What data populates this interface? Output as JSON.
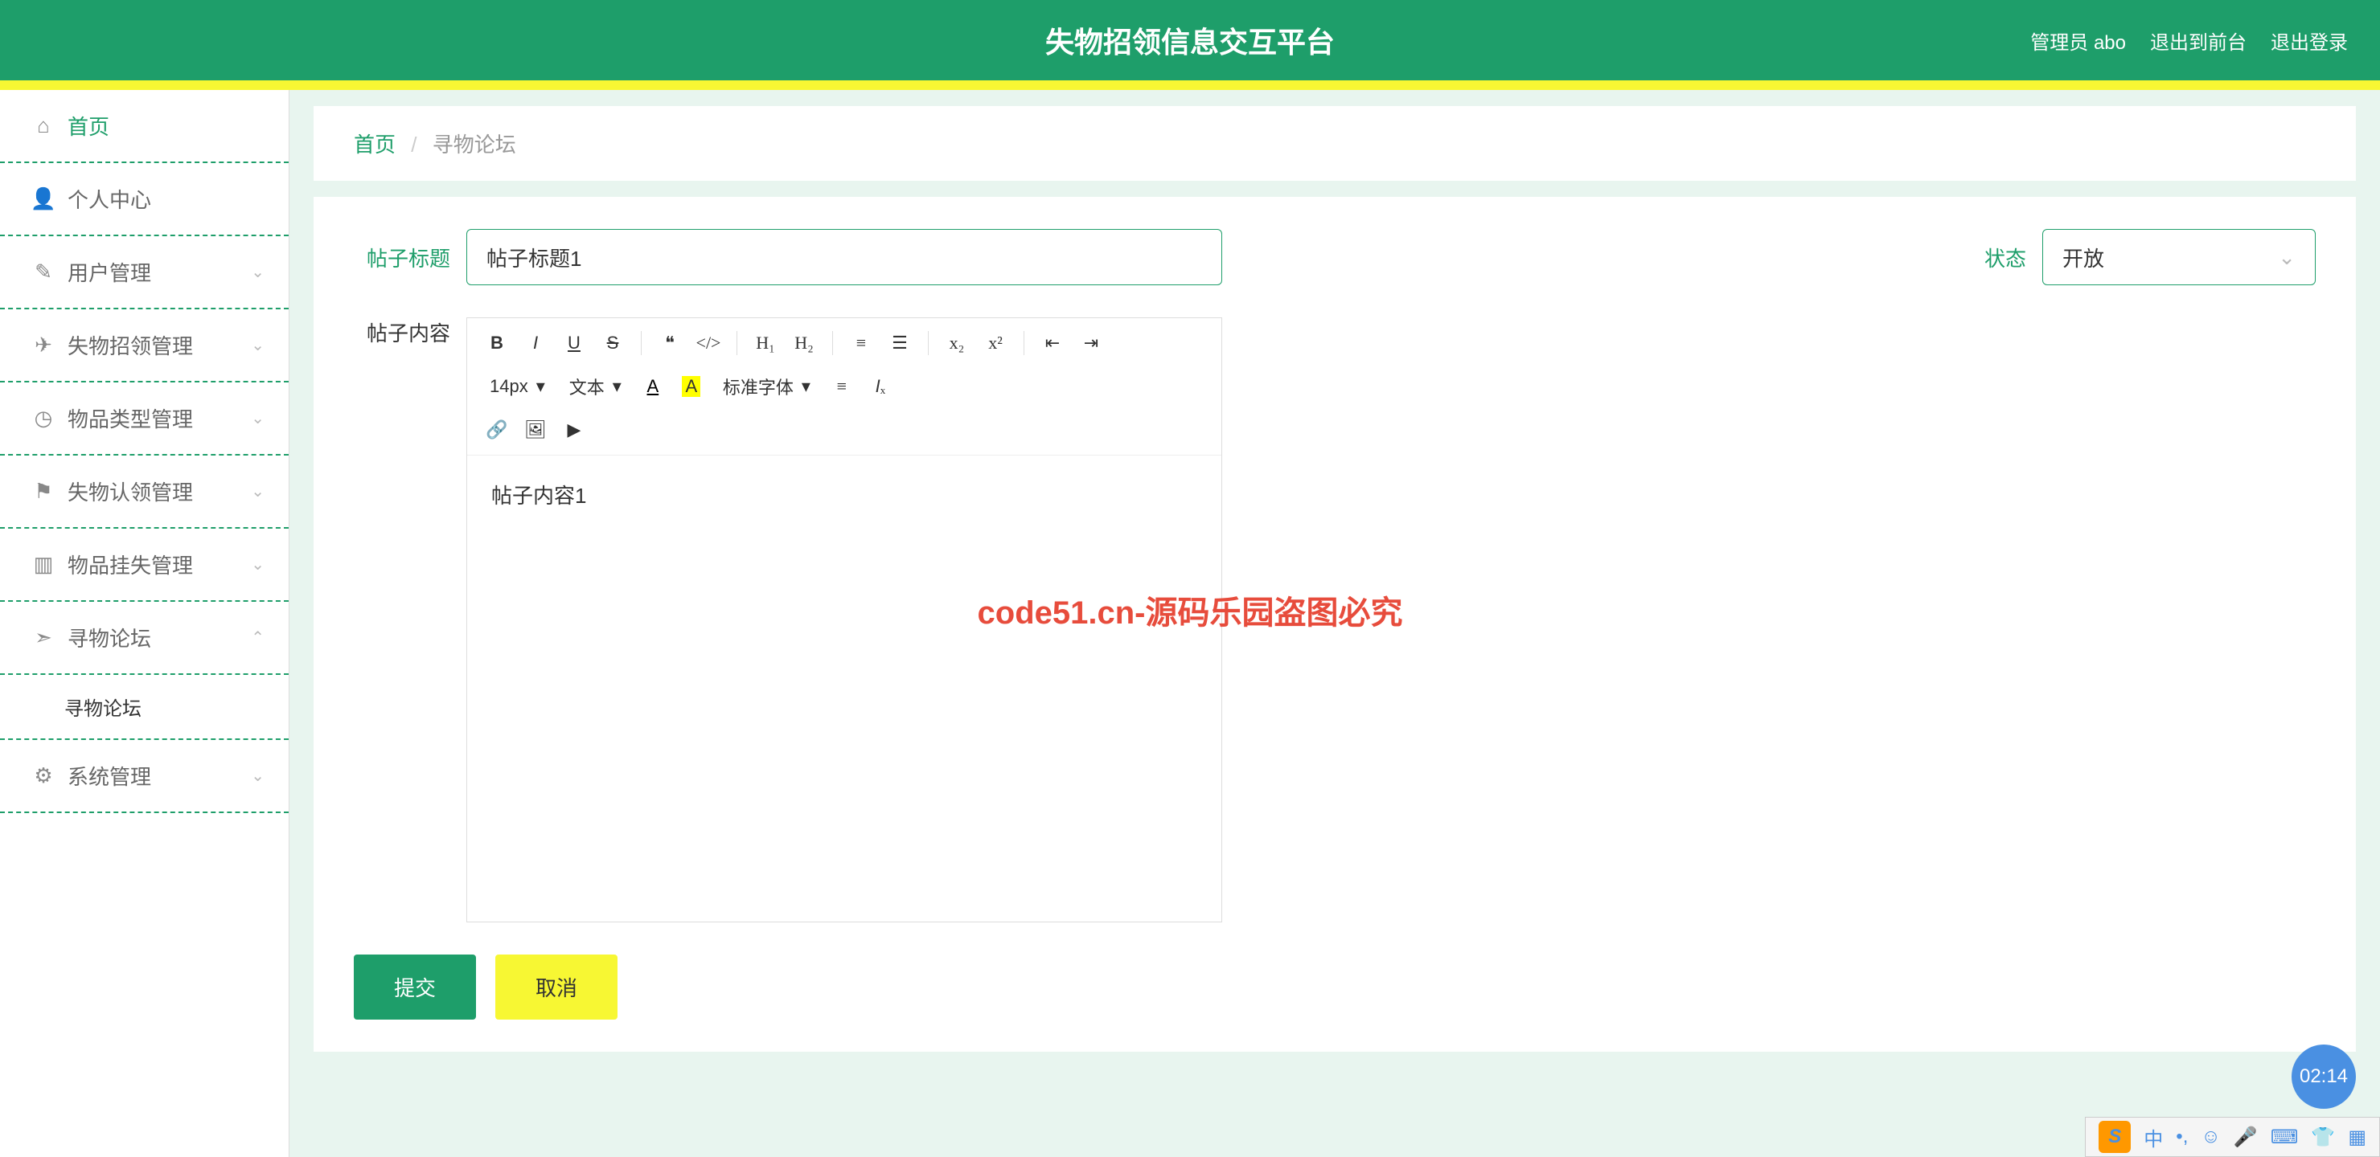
{
  "header": {
    "title": "失物招领信息交互平台",
    "admin_label": "管理员 abo",
    "back_front": "退出到前台",
    "logout": "退出登录"
  },
  "sidebar": {
    "items": [
      {
        "icon": "home",
        "label": "首页",
        "expandable": false
      },
      {
        "icon": "user",
        "label": "个人中心",
        "expandable": false
      },
      {
        "icon": "edit",
        "label": "用户管理",
        "expandable": true
      },
      {
        "icon": "send",
        "label": "失物招领管理",
        "expandable": true
      },
      {
        "icon": "clock",
        "label": "物品类型管理",
        "expandable": true
      },
      {
        "icon": "flag",
        "label": "失物认领管理",
        "expandable": true
      },
      {
        "icon": "bars",
        "label": "物品挂失管理",
        "expandable": true
      },
      {
        "icon": "nav",
        "label": "寻物论坛",
        "expandable": true,
        "expanded": true
      },
      {
        "icon": "gear",
        "label": "系统管理",
        "expandable": true
      }
    ],
    "submenu_forum": "寻物论坛"
  },
  "breadcrumb": {
    "home": "首页",
    "sep": "/",
    "current": "寻物论坛"
  },
  "form": {
    "title_label": "帖子标题",
    "title_value": "帖子标题1",
    "status_label": "状态",
    "status_value": "开放",
    "content_label": "帖子内容",
    "content_value": "帖子内容1",
    "submit": "提交",
    "cancel": "取消"
  },
  "editor_toolbar": {
    "font_size": "14px",
    "style_sel": "文本",
    "font_family": "标准字体"
  },
  "watermark_text": "code51.cn",
  "center_overlay": "code51.cn-源码乐园盗图必究",
  "clock": "02:14",
  "ime": {
    "s": "S",
    "lang": "中"
  }
}
